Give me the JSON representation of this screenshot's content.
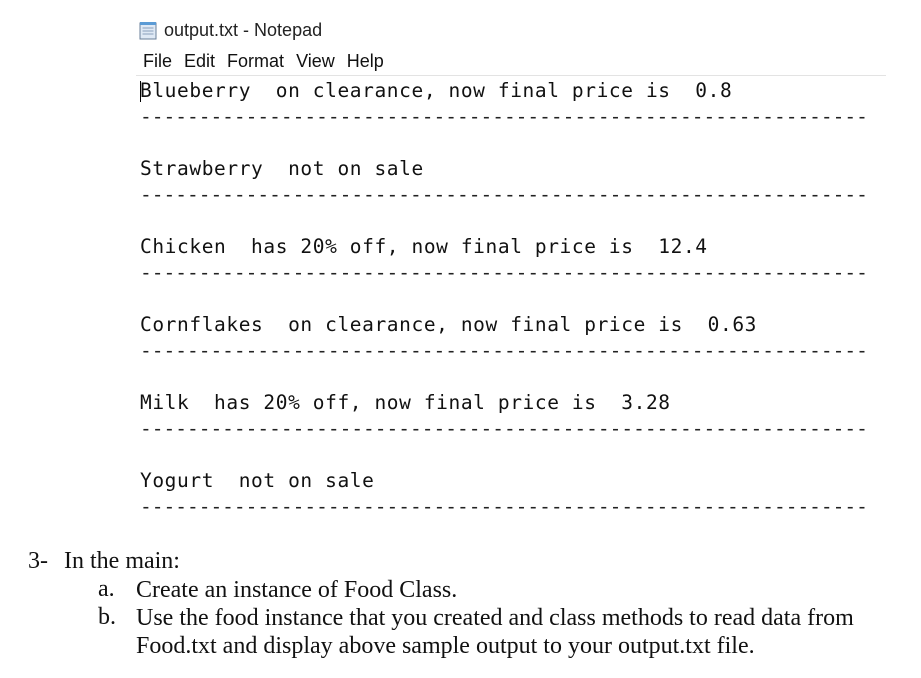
{
  "notepad": {
    "title": "output.txt - Notepad",
    "menu": [
      "File",
      "Edit",
      "Format",
      "View",
      "Help"
    ],
    "lines": [
      "Blueberry  on clearance, now final price is  0.8",
      "Strawberry  not on sale",
      "Chicken  has 20% off, now final price is  12.4",
      "Cornflakes  on clearance, now final price is  0.63",
      "Milk  has 20% off, now final price is  3.28",
      "Yogurt  not on sale"
    ],
    "separator": "--------------------------------------------------------------"
  },
  "doc": {
    "q_number": "3-",
    "q_text": "In the main:",
    "items": [
      {
        "letter": "a.",
        "text": "Create an instance of Food Class."
      },
      {
        "letter": "b.",
        "text": "Use the food instance that you created and class methods to read data from Food.txt and display above sample output to your output.txt file."
      }
    ]
  }
}
